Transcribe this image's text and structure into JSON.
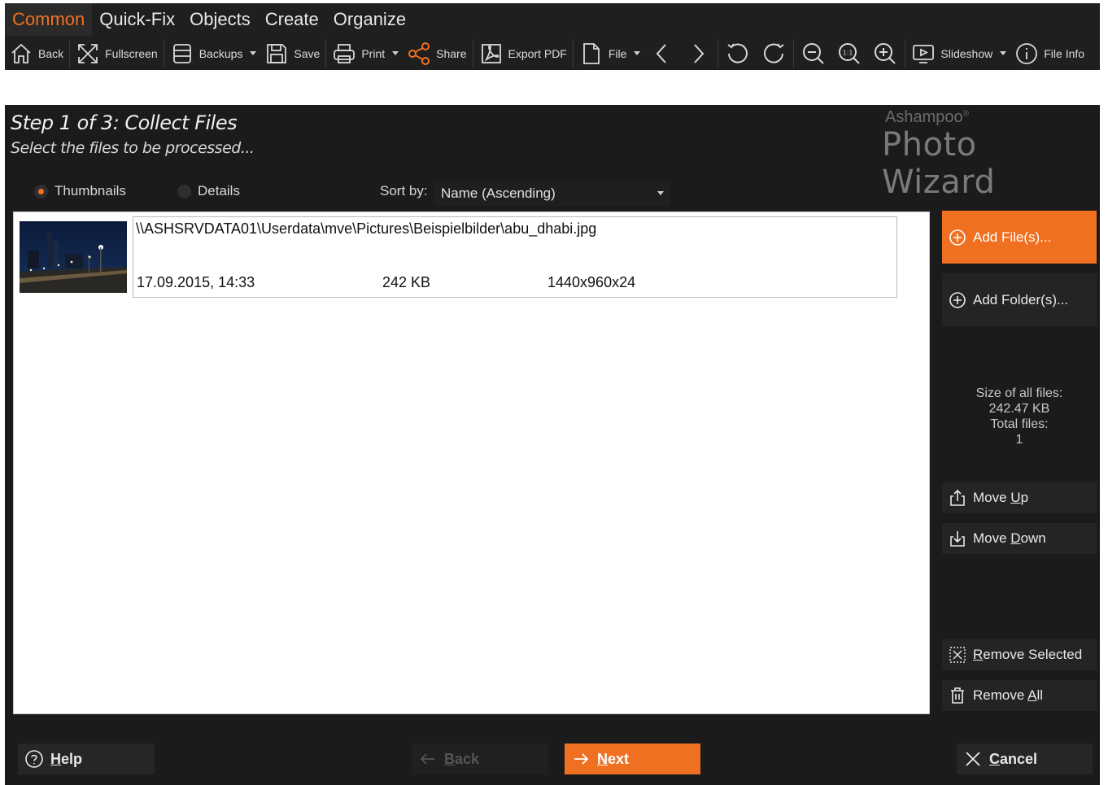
{
  "ribbon": {
    "tabs": [
      {
        "label": "Common",
        "active": true
      },
      {
        "label": "Quick-Fix",
        "active": false
      },
      {
        "label": "Objects",
        "active": false
      },
      {
        "label": "Create",
        "active": false
      },
      {
        "label": "Organize",
        "active": false
      }
    ],
    "toolbar": {
      "back": "Back",
      "fullscreen": "Fullscreen",
      "backups": "Backups",
      "save": "Save",
      "print": "Print",
      "share": "Share",
      "export_pdf": "Export PDF",
      "file": "File",
      "slideshow": "Slideshow",
      "file_info": "File Info"
    }
  },
  "wizard": {
    "step_title": "Step 1 of 3: Collect Files",
    "step_subtitle": "Select the files to be processed...",
    "brand": "Ashampoo",
    "brand_mark": "®",
    "product": "Photo Wizard",
    "view_options": [
      {
        "label": "Thumbnails",
        "selected": true
      },
      {
        "label": "Details",
        "selected": false
      }
    ],
    "sort_label": "Sort by:",
    "sort_value": "Name (Ascending)",
    "files": [
      {
        "path": "\\\\ASHSRVDATA01\\Userdata\\mve\\Pictures\\Beispielbilder\\abu_dhabi.jpg",
        "date": "17.09.2015, 14:33",
        "size": "242 KB",
        "dimensions": "1440x960x24"
      }
    ],
    "side": {
      "add_files": "Add File(s)...",
      "add_folder": "Add Folder(s)...",
      "size_label": "Size of all files:",
      "size_value": "242.47 KB",
      "total_label": "Total files:",
      "total_value": "1",
      "move_up_pre": "Move ",
      "move_up_key": "U",
      "move_up_post": "p",
      "move_down_pre": "Move ",
      "move_down_key": "D",
      "move_down_post": "own",
      "remove_selected_key": "R",
      "remove_selected_post": "emove Selected",
      "remove_all_pre": "Remove ",
      "remove_all_key": "A",
      "remove_all_post": "ll"
    },
    "footer": {
      "help_key": "H",
      "help_post": "elp",
      "back_key": "B",
      "back_post": "ack",
      "next_key": "N",
      "next_post": "ext",
      "cancel_key": "C",
      "cancel_post": "ancel"
    }
  },
  "colors": {
    "accent": "#f07022",
    "dialog_bg": "#1b1b1b",
    "ribbon_bg": "#1f1f1f",
    "button_bg": "#242424"
  }
}
